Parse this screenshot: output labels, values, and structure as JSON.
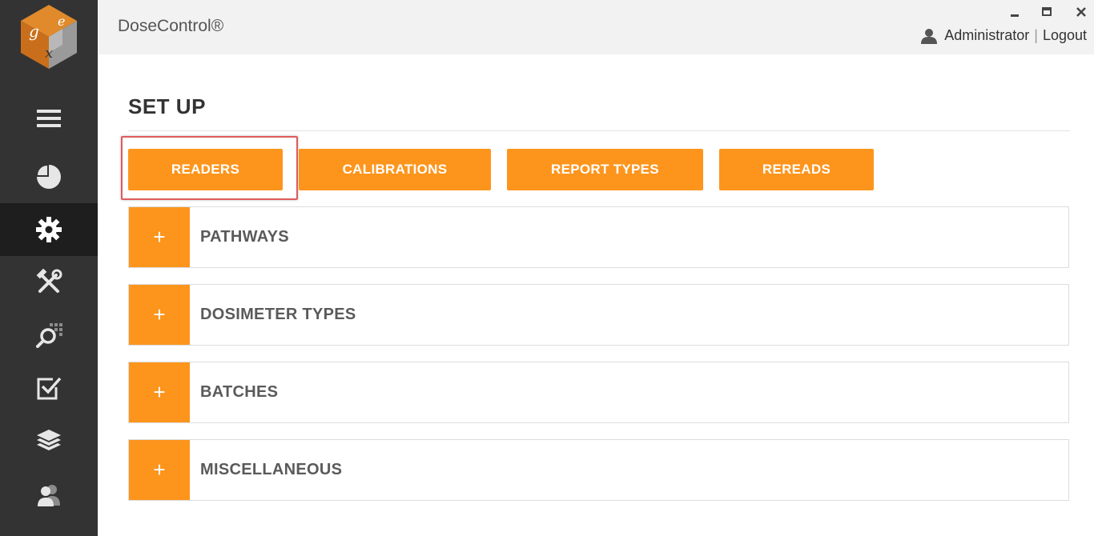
{
  "app": {
    "title": "DoseControl®",
    "user": "Administrator",
    "logout": "Logout"
  },
  "sidebar": {
    "items": [
      {
        "icon": "hamburger-menu-icon"
      },
      {
        "icon": "pie-chart-icon"
      },
      {
        "icon": "gear-icon",
        "active": true
      },
      {
        "icon": "tools-icon"
      },
      {
        "icon": "search-grid-icon"
      },
      {
        "icon": "checkbox-icon"
      },
      {
        "icon": "layers-icon"
      },
      {
        "icon": "users-icon"
      }
    ]
  },
  "page": {
    "title": "SET UP",
    "tabs": [
      {
        "label": "READERS",
        "highlighted": true
      },
      {
        "label": "CALIBRATIONS"
      },
      {
        "label": "REPORT TYPES"
      },
      {
        "label": "REREADS"
      }
    ],
    "panels": [
      {
        "label": "PATHWAYS",
        "toggle": "+"
      },
      {
        "label": "DOSIMETER TYPES",
        "toggle": "+"
      },
      {
        "label": "BATCHES",
        "toggle": "+"
      },
      {
        "label": "MISCELLANEOUS",
        "toggle": "+"
      }
    ]
  },
  "colors": {
    "accent": "#fd951d",
    "sidebar": "#333333",
    "sidebar_active": "#1e1e1e",
    "highlight": "#e05a5a"
  }
}
